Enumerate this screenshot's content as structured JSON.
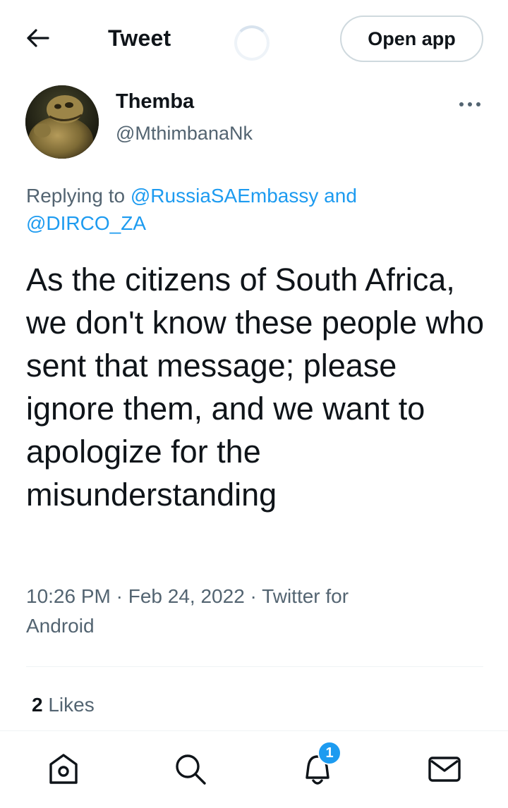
{
  "header": {
    "title": "Tweet",
    "open_app_label": "Open app",
    "back_icon": "arrow-left-icon",
    "more_icon": "ellipsis-icon"
  },
  "author": {
    "display_name": "Themba",
    "handle": "@MthimbanaNk",
    "avatar": "profile-avatar"
  },
  "reply": {
    "prefix": "Replying to ",
    "mention_1": "@RussiaSAEmbassy",
    "connector": " and",
    "mention_2": "@DIRCO_ZA"
  },
  "tweet": {
    "text": "As the citizens of South Africa, we don't know these people who sent that message; please ignore them, and we want to apologize for the misunderstanding",
    "time": "10:26 PM",
    "date": "Feb 24, 2022",
    "source_part1": "Twitter for",
    "source_part2": "Android",
    "separator": " · "
  },
  "stats": {
    "likes_count": "2",
    "likes_label": " Likes"
  },
  "nav": {
    "items": [
      "home-icon",
      "search-icon",
      "notifications-icon",
      "messages-icon"
    ],
    "notifications_badge": "1"
  },
  "colors": {
    "accent": "#1d9bf0",
    "text_primary": "#0f1419",
    "text_secondary": "#536471",
    "border": "#cfd9de"
  }
}
